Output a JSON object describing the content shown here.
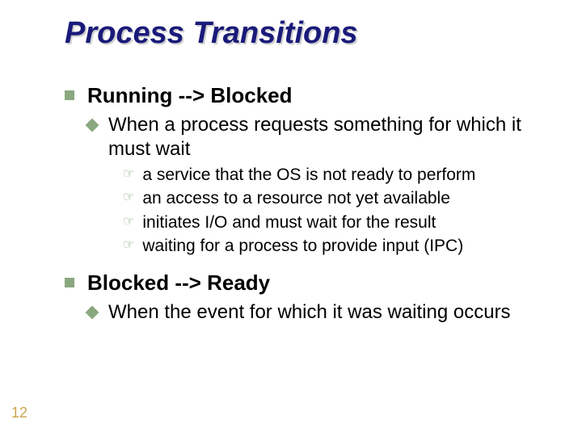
{
  "title": "Process Transitions",
  "sections": [
    {
      "heading": "Running --> Blocked",
      "sub": {
        "text": "When a process requests something for which it must wait",
        "items": [
          "a service that the OS is not ready to perform",
          "an access to a resource not yet available",
          "initiates I/O and must wait for the result",
          "waiting for a process to provide input (IPC)"
        ]
      }
    },
    {
      "heading": "Blocked --> Ready",
      "sub": {
        "text": "When the event for which it was waiting occurs",
        "items": []
      }
    }
  ],
  "page_number": "12"
}
